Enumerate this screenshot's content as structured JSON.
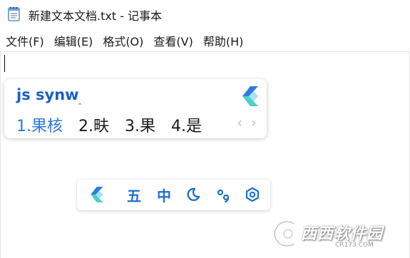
{
  "window": {
    "title": "新建文本文档.txt - 记事本"
  },
  "menu": {
    "items": [
      {
        "label": "文件(F)"
      },
      {
        "label": "编辑(E)"
      },
      {
        "label": "格式(O)"
      },
      {
        "label": "查看(V)"
      },
      {
        "label": "帮助(H)"
      }
    ]
  },
  "editor": {
    "content": ""
  },
  "ime": {
    "composition": "js synw",
    "composition_cursor": "‸",
    "logo_icon": "wubi-logo-icon",
    "candidates": [
      {
        "label": "1.果核",
        "selected": true
      },
      {
        "label": "2.畉",
        "selected": false
      },
      {
        "label": "3.果",
        "selected": false
      },
      {
        "label": "4.是",
        "selected": false
      }
    ],
    "prev_page": "‹",
    "next_page": "›"
  },
  "ime_toolbar": {
    "logo_icon": "wubi-logo-icon",
    "mode_label": "五",
    "lang_label": "中",
    "width_icon": "half-moon-icon",
    "punct_icon": "punctuation-icon",
    "settings_icon": "settings-gear-icon"
  },
  "watermark": {
    "text": "西西软件园",
    "sub": "CR173.COM"
  },
  "colors": {
    "accent": "#2b78d8",
    "composition": "#1a5fc8",
    "toolbar_icon": "#1f6fd6"
  }
}
